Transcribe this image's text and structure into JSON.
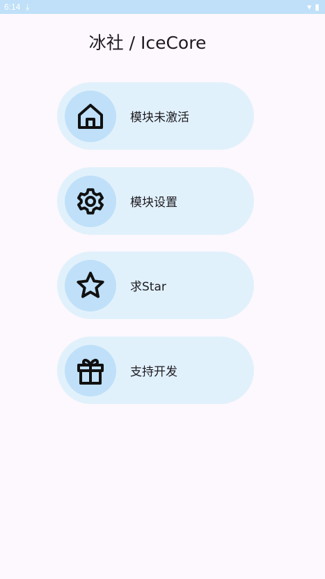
{
  "status_bar": {
    "time": "6:14",
    "download_glyph": "⤓",
    "wifi_glyph": "▾",
    "battery_glyph": "▮"
  },
  "app": {
    "title": "冰社 / IceCore"
  },
  "menu": [
    {
      "label": "模块未激活",
      "icon": "home-icon"
    },
    {
      "label": "模块设置",
      "icon": "gear-icon"
    },
    {
      "label": "求Star",
      "icon": "star-icon"
    },
    {
      "label": "支持开发",
      "icon": "gift-icon"
    }
  ],
  "colors": {
    "status_bar": "#bfe0f8",
    "card": "#e1f1fc",
    "icon_circle": "#bfe0f8",
    "background": "#fdf8fd"
  }
}
